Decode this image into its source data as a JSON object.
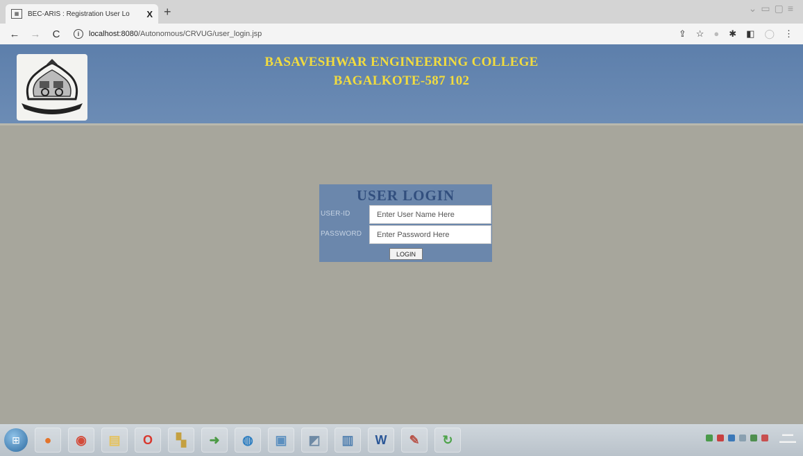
{
  "browser": {
    "tab_title": "BEC-ARIS : Registration User Lo",
    "tab_close": "X",
    "new_tab": "+",
    "url_host": "localhost:8080",
    "url_path": "/Autonomous/CRVUG/user_login.jsp"
  },
  "header": {
    "line1": "BASAVESHWAR ENGINEERING COLLEGE",
    "line2": "BAGALKOTE-587 102"
  },
  "login": {
    "title": "USER LOGIN",
    "userid_label": "USER-ID",
    "userid_placeholder": "Enter User Name Here",
    "password_label": "PASSWORD",
    "password_placeholder": "Enter Password Here",
    "button_label": "LOGIN"
  },
  "colors": {
    "header_bg": "#5d7fab",
    "header_text": "#f2dc3e",
    "page_bg": "#a7a69c",
    "login_box_bg": "#6b87ac",
    "login_title": "#324f7e"
  },
  "taskbar": {
    "apps": [
      {
        "icon": "firefox-icon",
        "color": "#e3742b"
      },
      {
        "icon": "chrome-icon",
        "color": "#d34b3a"
      },
      {
        "icon": "file-explorer-icon",
        "color": "#e6c25a"
      },
      {
        "icon": "opera-icon",
        "color": "#d8382e"
      },
      {
        "icon": "app-icon",
        "color": "#c4a040"
      },
      {
        "icon": "arrow-app-icon",
        "color": "#4c9a45"
      },
      {
        "icon": "circle-app-icon",
        "color": "#2f7fc1"
      },
      {
        "icon": "image-app-icon",
        "color": "#5b8fbf"
      },
      {
        "icon": "tool-app-icon",
        "color": "#6e8aa5"
      },
      {
        "icon": "window-app-icon",
        "color": "#4f7faf"
      },
      {
        "icon": "word-icon",
        "color": "#2b5797"
      },
      {
        "icon": "pen-app-icon",
        "color": "#b8544a"
      },
      {
        "icon": "refresh-app-icon",
        "color": "#4ea34a"
      }
    ]
  }
}
